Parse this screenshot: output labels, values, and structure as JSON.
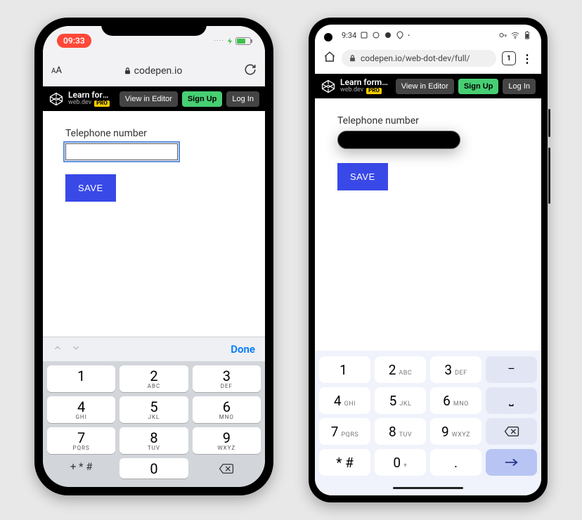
{
  "ios": {
    "status": {
      "time": "09:33"
    },
    "urlbar": {
      "domain": "codepen.io"
    },
    "codepen": {
      "title": "Learn forms – virt…",
      "author": "web.dev",
      "pro": "PRO",
      "view_in_editor": "View in Editor",
      "signup": "Sign Up",
      "login": "Log In"
    },
    "form": {
      "label": "Telephone number",
      "save": "SAVE"
    },
    "kb_toolbar": {
      "done": "Done"
    },
    "keys": {
      "r1": [
        {
          "n": "1",
          "l": ""
        },
        {
          "n": "2",
          "l": "ABC"
        },
        {
          "n": "3",
          "l": "DEF"
        }
      ],
      "r2": [
        {
          "n": "4",
          "l": "GHI"
        },
        {
          "n": "5",
          "l": "JKL"
        },
        {
          "n": "6",
          "l": "MNO"
        }
      ],
      "r3": [
        {
          "n": "7",
          "l": "PQRS"
        },
        {
          "n": "8",
          "l": "TUV"
        },
        {
          "n": "9",
          "l": "WXYZ"
        }
      ],
      "sym": "+ * #",
      "zero": "0"
    }
  },
  "android": {
    "status": {
      "time": "9:34"
    },
    "urlbar": {
      "url": "codepen.io/web-dot-dev/full/",
      "tabs": "1"
    },
    "codepen": {
      "title": "Learn forms – virt…",
      "author": "web.dev",
      "pro": "PRO",
      "view_in_editor": "View in Editor",
      "signup": "Sign Up",
      "login": "Log In"
    },
    "form": {
      "label": "Telephone number",
      "save": "SAVE"
    },
    "keys": {
      "r1": [
        {
          "n": "1",
          "l": ""
        },
        {
          "n": "2",
          "l": "ABC"
        },
        {
          "n": "3",
          "l": "DEF"
        },
        {
          "n": "–",
          "l": ""
        }
      ],
      "r2": [
        {
          "n": "4",
          "l": "GHI"
        },
        {
          "n": "5",
          "l": "JKL"
        },
        {
          "n": "6",
          "l": "MNO"
        },
        {
          "n": "⎵",
          "l": ""
        }
      ],
      "r3": [
        {
          "n": "7",
          "l": "PQRS"
        },
        {
          "n": "8",
          "l": "TUV"
        },
        {
          "n": "9",
          "l": "WXYZ"
        }
      ],
      "r4": [
        {
          "n": "* #",
          "l": ""
        },
        {
          "n": "0",
          "l": "+"
        },
        {
          "n": ".",
          "l": ""
        },
        {
          "n": "→",
          "l": ""
        }
      ]
    }
  }
}
